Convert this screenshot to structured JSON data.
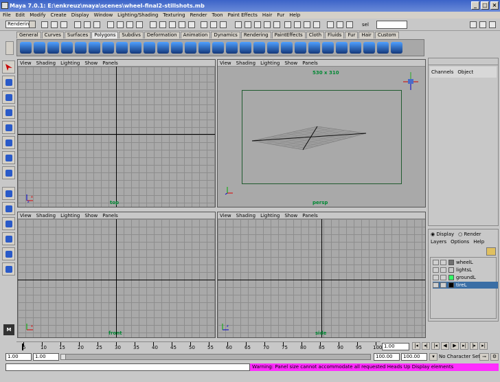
{
  "window": {
    "title": "Maya 7.0.1: E:\\enkreuz\\maya\\scenes\\wheel-final2-stillshots.mb"
  },
  "menubar": [
    "File",
    "Edit",
    "Modify",
    "Create",
    "Display",
    "Window",
    "Lighting/Shading",
    "Texturing",
    "Render",
    "Toon",
    "Paint Effects",
    "Hair",
    "Fur",
    "Help"
  ],
  "status": {
    "mode": "Rendering",
    "sel_label": "sel"
  },
  "shelf_tabs": [
    "General",
    "Curves",
    "Surfaces",
    "Polygons",
    "Subdivs",
    "Deformation",
    "Animation",
    "Dynamics",
    "Rendering",
    "PaintEffects",
    "Cloth",
    "Fluids",
    "Fur",
    "Hair",
    "Custom"
  ],
  "shelf_active": "Polygons",
  "panel_menu": [
    "View",
    "Shading",
    "Lighting",
    "Show",
    "Panels"
  ],
  "viewports": {
    "top": {
      "label": "top"
    },
    "persp": {
      "label": "persp",
      "resolution": "530 x 310"
    },
    "front": {
      "label": "front"
    },
    "side": {
      "label": "side"
    }
  },
  "channel_box": {
    "tabs": [
      "Channels",
      "Object"
    ]
  },
  "layer_editor": {
    "radio_display": "Display",
    "radio_render": "Render",
    "menus": [
      "Layers",
      "Options",
      "Help"
    ],
    "layers": [
      {
        "name": "wheelL",
        "color": "#707070",
        "selected": false
      },
      {
        "name": "lightsL",
        "color": "#c8c8c8",
        "selected": false
      },
      {
        "name": "groundL",
        "color": "#33ff66",
        "selected": false
      },
      {
        "name": "tireL",
        "color": "#000000",
        "selected": true
      }
    ]
  },
  "time_slider": {
    "ticks": [
      "5",
      "10",
      "15",
      "20",
      "25",
      "30",
      "35",
      "40",
      "45",
      "50",
      "55",
      "60",
      "65",
      "70",
      "75",
      "80",
      "85",
      "90",
      "95",
      "100"
    ],
    "current_frame": "1.00"
  },
  "range": {
    "start": "1.00",
    "start2": "1.00",
    "end": "100.00",
    "end2": "100.00",
    "character": "No Character Set"
  },
  "help_line": {
    "warning": "Warning: Panel size cannot accommodate all requested Heads Up Display elements"
  },
  "colors": {
    "viewport_bg": "#a9a9a9",
    "grid_line": "#8d8d8d",
    "warning_bg": "#ff2dff",
    "hud_text": "#008833"
  }
}
